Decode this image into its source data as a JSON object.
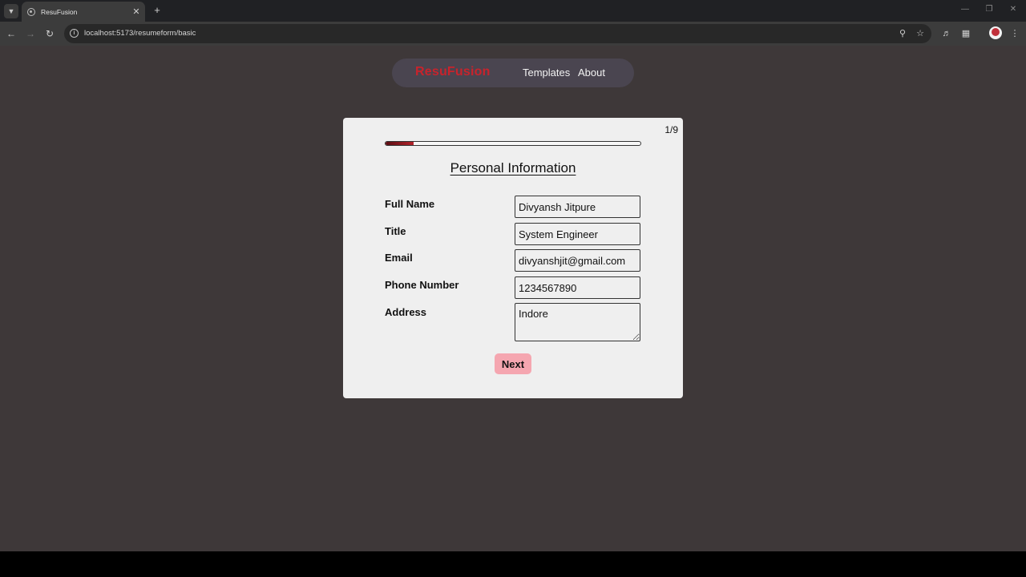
{
  "browser": {
    "tab_title": "ResuFusion",
    "url": "localhost:5173/resumeform/basic"
  },
  "navbar": {
    "brand": "ResuFusion",
    "links": [
      "Templates",
      "About"
    ]
  },
  "form": {
    "step": "1/9",
    "progress": 0.11,
    "title": "Personal Information",
    "fields": [
      {
        "label": "Full Name",
        "value": "Divyansh Jitpure"
      },
      {
        "label": "Title",
        "value": "System Engineer"
      },
      {
        "label": "Email",
        "value": "divyanshjit@gmail.com"
      },
      {
        "label": "Phone Number",
        "value": "1234567890"
      },
      {
        "label": "Address",
        "value": "Indore"
      }
    ],
    "next_label": "Next"
  },
  "colors": {
    "page_background": "#3e3839",
    "brand": "#c8232c",
    "next_button": "#f5a6b0",
    "progress_fill": "#b2232b"
  }
}
